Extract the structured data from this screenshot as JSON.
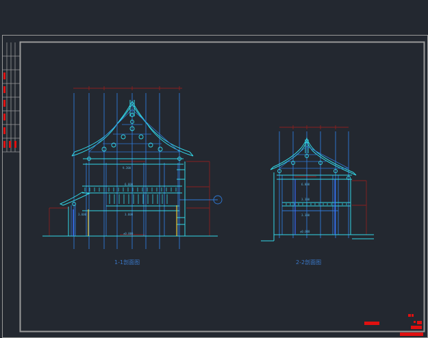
{
  "drawing": {
    "section_1": {
      "caption": "1-1剖面图"
    },
    "section_2": {
      "caption": "2-2剖面图"
    },
    "level_marks_1": [
      "9.200",
      "6.600",
      "3.600",
      "±0.000"
    ],
    "level_marks_2": [
      "6.000",
      "3.300",
      "±0.000"
    ]
  },
  "colors": {
    "background": "#232830",
    "frame": "#9a9a9a",
    "structure": "#2f7ad8",
    "outline": "#33d8e8",
    "dimension": "#8a2020",
    "accent": "#e8c838",
    "title_block_red": "#e01010"
  }
}
